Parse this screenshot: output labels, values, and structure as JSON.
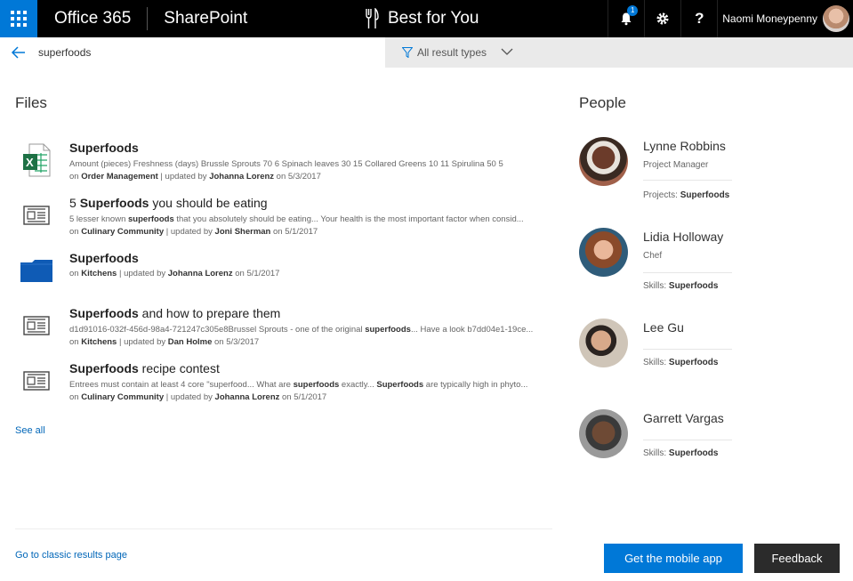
{
  "suite": {
    "brand": "Office 365",
    "app": "SharePoint",
    "site_title": "Best for You",
    "notification_count": "1",
    "help_label": "?",
    "user_name": "Naomi Moneypenny"
  },
  "search": {
    "query": "superfoods",
    "filter_label": "All result types"
  },
  "files": {
    "heading": "Files",
    "see_all": "See all",
    "items": [
      {
        "icon": "excel-file-icon",
        "title": "Superfoods",
        "title_rest": "",
        "title_prefix": "",
        "line1": "Amount (pieces) Freshness (days) Brussle Sprouts 70 6 Spinach leaves 30 15 Collared Greens 10 11 Spirulina 50 5",
        "line2_pre": "on ",
        "line2_site": "Order Management",
        "line2_mid": " | updated by ",
        "line2_author": "Johanna Lorenz",
        "line2_post": " on 5/3/2017"
      },
      {
        "icon": "news-page-icon",
        "title_prefix": "5 ",
        "title": "Superfoods",
        "title_rest": " you should be eating",
        "line1_pre": "5 lesser known ",
        "line1_bold": "superfoods",
        "line1_post": " that you absolutely should be eating... Your health is the most important factor when consid...",
        "line2_pre": "on ",
        "line2_site": "Culinary Community",
        "line2_mid": " | updated by ",
        "line2_author": "Joni Sherman",
        "line2_post": " on 5/1/2017"
      },
      {
        "icon": "folder-icon",
        "title_prefix": "",
        "title": "Superfoods",
        "title_rest": "",
        "line2_pre": "on ",
        "line2_site": "Kitchens",
        "line2_mid": " | updated by ",
        "line2_author": "Johanna Lorenz",
        "line2_post": " on 5/1/2017"
      },
      {
        "icon": "news-page-icon",
        "title_prefix": "",
        "title": "Superfoods",
        "title_rest": " and how to prepare them",
        "line1_pre": "d1d91016-032f-456d-98a4-721247c305e8Brussel Sprouts - one of the original ",
        "line1_bold": "superfoods",
        "line1_post": "... Have a look b7dd04e1-19ce...",
        "line2_pre": "on ",
        "line2_site": "Kitchens",
        "line2_mid": " | updated by ",
        "line2_author": "Dan Holme",
        "line2_post": " on 5/3/2017"
      },
      {
        "icon": "news-page-icon",
        "title_prefix": "",
        "title": "Superfoods",
        "title_rest": " recipe contest",
        "line1_pre": "Entrees must contain at least 4 core \"superfood... What are ",
        "line1_bold": "superfoods",
        "line1_mid": " exactly... ",
        "line1_bold2": "Superfoods",
        "line1_post": " are typically high in phyto...",
        "line2_pre": "on ",
        "line2_site": "Culinary Community",
        "line2_mid": " | updated by ",
        "line2_author": "Johanna Lorenz",
        "line2_post": " on 5/1/2017"
      }
    ]
  },
  "people": {
    "heading": "People",
    "items": [
      {
        "name": "Lynne Robbins",
        "role": "Project Manager",
        "skill_label": "Projects: ",
        "skill_value": "Superfoods"
      },
      {
        "name": "Lidia Holloway",
        "role": "Chef",
        "skill_label": "Skills: ",
        "skill_value": "Superfoods"
      },
      {
        "name": "Lee Gu",
        "role": "",
        "skill_label": "Skills: ",
        "skill_value": "Superfoods"
      },
      {
        "name": "Garrett Vargas",
        "role": "",
        "skill_label": "Skills: ",
        "skill_value": "Superfoods"
      }
    ]
  },
  "footer": {
    "classic_link": "Go to classic results page",
    "mobile_button": "Get the mobile app",
    "feedback_button": "Feedback"
  },
  "colors": {
    "accent": "#0078d7",
    "link": "#0066b8",
    "topbar": "#000000",
    "feedback_bg": "#2b2b2b"
  }
}
